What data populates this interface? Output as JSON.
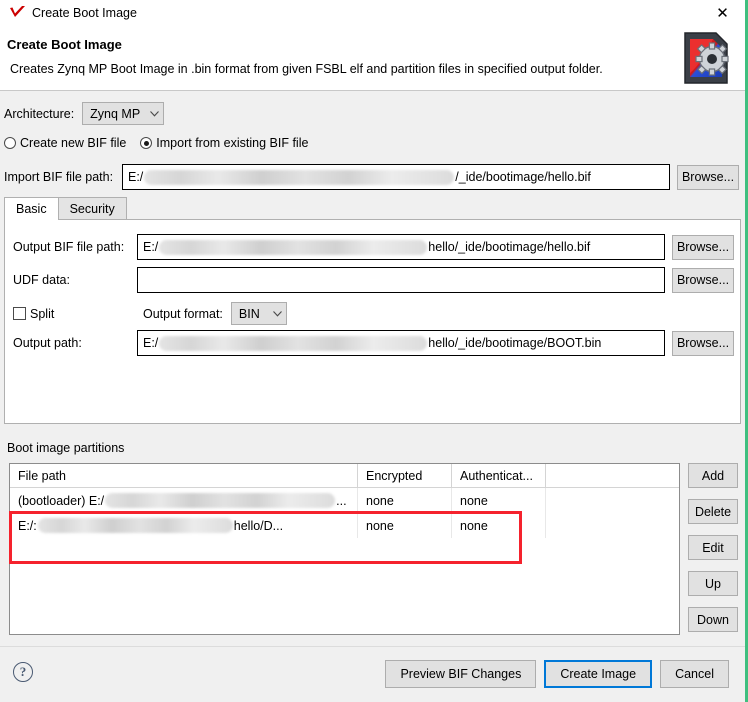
{
  "window": {
    "title": "Create Boot Image",
    "icon": "xilinx-check-icon",
    "close_label": "✕"
  },
  "header": {
    "title": "Create Boot Image",
    "description": "Creates Zynq MP Boot Image in .bin format from given FSBL elf and partition files in specified output folder.",
    "image_icon": "sd-card-gear-icon"
  },
  "architecture": {
    "label": "Architecture:",
    "value": "Zynq MP",
    "caret": "⌄"
  },
  "bif_mode": {
    "create_new_label": "Create new BIF file",
    "import_existing_label": "Import from existing BIF file",
    "selected": "import_existing"
  },
  "import_bif": {
    "label": "Import BIF file path:",
    "value_prefix": "E:/",
    "value_suffix": "/_ide/bootimage/hello.bif",
    "browse_label": "Browse..."
  },
  "tabs": [
    {
      "label": "Basic",
      "active": true
    },
    {
      "label": "Security",
      "active": false
    }
  ],
  "basic": {
    "output_bif": {
      "label": "Output BIF file path:",
      "value_prefix": "E:/",
      "value_suffix": "hello/_ide/bootimage/hello.bif",
      "browse_label": "Browse..."
    },
    "udf_data": {
      "label": "UDF data:",
      "value": "",
      "browse_label": "Browse..."
    },
    "split": {
      "label": "Split",
      "checked": false
    },
    "output_format": {
      "label": "Output format:",
      "value": "BIN",
      "caret": "⌄"
    },
    "output_path": {
      "label": "Output path:",
      "value_prefix": "E:/",
      "value_suffix": "hello/_ide/bootimage/BOOT.bin",
      "browse_label": "Browse..."
    }
  },
  "partitions": {
    "section_label": "Boot image partitions",
    "columns": [
      "File path",
      "Encrypted",
      "Authenticat..."
    ],
    "rows": [
      {
        "file_path_prefix": "(bootloader) E:/",
        "file_path_suffix": "...",
        "encrypted": "none",
        "authenticated": "none"
      },
      {
        "file_path_prefix": "E:/:",
        "file_path_suffix": "hello/D...",
        "encrypted": "none",
        "authenticated": "none"
      }
    ],
    "buttons": [
      "Add",
      "Delete",
      "Edit",
      "Up",
      "Down"
    ]
  },
  "footer": {
    "help_glyph": "?",
    "preview_label": "Preview BIF Changes",
    "create_label": "Create Image",
    "cancel_label": "Cancel"
  },
  "colors": {
    "accent": "#0078d7",
    "highlight": "#f5222d",
    "artifact": "#3fbf7f",
    "chrome": "#f0f0f0"
  }
}
